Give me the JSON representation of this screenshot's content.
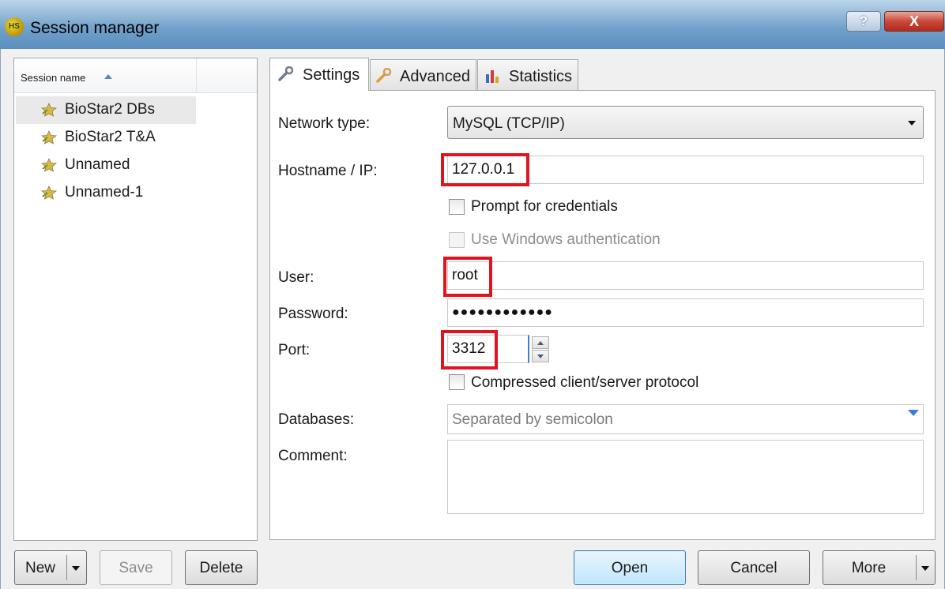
{
  "window": {
    "title": "Session manager",
    "app_icon_text": "HS",
    "help_label": "?",
    "close_label": "X"
  },
  "session_list": {
    "header": "Session name",
    "items": [
      {
        "label": "BioStar2 DBs",
        "selected": true
      },
      {
        "label": "BioStar2 T&A",
        "selected": false
      },
      {
        "label": "Unnamed",
        "selected": false
      },
      {
        "label": "Unnamed-1",
        "selected": false
      }
    ]
  },
  "tabs": [
    {
      "label": "Settings",
      "icon": "wrench-icon",
      "active": true
    },
    {
      "label": "Advanced",
      "icon": "wrench-icon",
      "active": false
    },
    {
      "label": "Statistics",
      "icon": "bar-chart-icon",
      "active": false
    }
  ],
  "settings": {
    "network_type_label": "Network type:",
    "network_type_value": "MySQL (TCP/IP)",
    "hostname_label": "Hostname / IP:",
    "hostname_value": "127.0.0.1",
    "prompt_credentials_label": "Prompt for credentials",
    "prompt_credentials_checked": false,
    "windows_auth_label": "Use Windows authentication",
    "windows_auth_checked": false,
    "user_label": "User:",
    "user_value": "root",
    "password_label": "Password:",
    "password_value": "●●●●●●●●●●●●",
    "port_label": "Port:",
    "port_value": "3312",
    "compressed_label": "Compressed client/server protocol",
    "compressed_checked": false,
    "databases_label": "Databases:",
    "databases_placeholder": "Separated by semicolon",
    "comment_label": "Comment:",
    "comment_value": ""
  },
  "buttons": {
    "new": "New",
    "save": "Save",
    "delete": "Delete",
    "open": "Open",
    "cancel": "Cancel",
    "more": "More"
  },
  "colors": {
    "highlight_red": "#e0141f",
    "titlebar_blue": "#6f9fca",
    "selected_row": "#e9e9ea"
  }
}
